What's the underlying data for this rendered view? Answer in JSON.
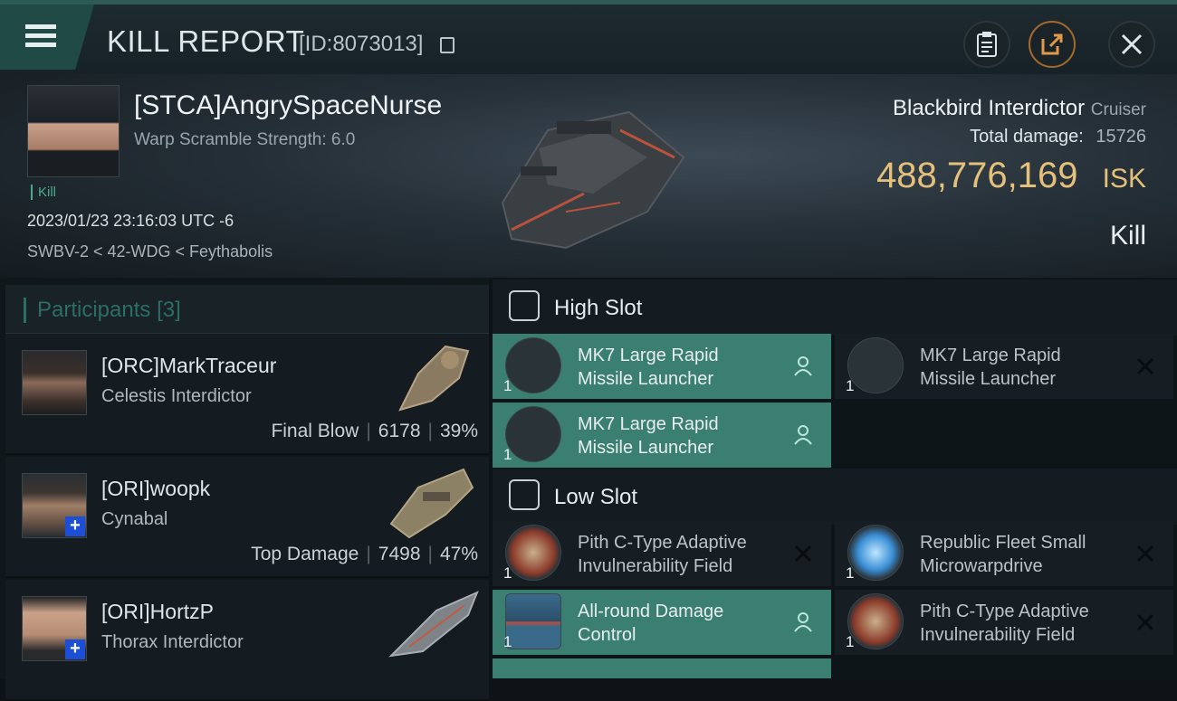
{
  "header": {
    "title": "KILL REPORT",
    "id_label": "[ID:8073013]"
  },
  "victim": {
    "name": "[STCA]AngrySpaceNurse",
    "subtitle": "Warp Scramble Strength: 6.0",
    "tag": "Kill",
    "timestamp": "2023/01/23 23:16:03 UTC -6",
    "location": "SWBV-2 < 42-WDG < Feythabolis",
    "ship_name": "Blackbird Interdictor",
    "ship_class": "Cruiser",
    "total_damage_label": "Total damage:",
    "total_damage": "15726",
    "isk_value": "488,776,169",
    "isk_unit": "ISK",
    "result": "Kill"
  },
  "participants": {
    "heading": "Participants",
    "count": "[3]",
    "rows": [
      {
        "name": "[ORC]MarkTraceur",
        "ship": "Celestis Interdictor",
        "role": "Final Blow",
        "damage": "6178",
        "percent": "39%"
      },
      {
        "name": "[ORI]woopk",
        "ship": "Cynabal",
        "role": "Top Damage",
        "damage": "7498",
        "percent": "47%"
      },
      {
        "name": "[ORI]HortzP",
        "ship": "Thorax Interdictor"
      }
    ]
  },
  "slots": {
    "high_label": "High Slot",
    "low_label": "Low Slot",
    "high": [
      {
        "line1": "MK7 Large Rapid",
        "line2": "Missile Launcher",
        "qty": "1",
        "status": "fitted"
      },
      {
        "line1": "MK7 Large Rapid",
        "line2": "Missile Launcher",
        "qty": "1",
        "status": "destroyed"
      },
      {
        "line1": "MK7 Large Rapid",
        "line2": "Missile Launcher",
        "qty": "1",
        "status": "fitted"
      }
    ],
    "low": [
      {
        "line1": "Pith C-Type Adaptive",
        "line2": "Invulnerability Field",
        "qty": "1",
        "status": "destroyed"
      },
      {
        "line1": "Republic Fleet Small",
        "line2": "Microwarpdrive",
        "qty": "1",
        "status": "destroyed"
      },
      {
        "line1": "All-round Damage",
        "line2": "Control",
        "qty": "1",
        "status": "fitted"
      },
      {
        "line1": "Pith C-Type Adaptive",
        "line2": "Invulnerability Field",
        "qty": "1",
        "status": "destroyed"
      }
    ]
  },
  "colors": {
    "accent": "#3b7f73",
    "isk": "#e4c07a",
    "badge": "#1d4fd6"
  }
}
